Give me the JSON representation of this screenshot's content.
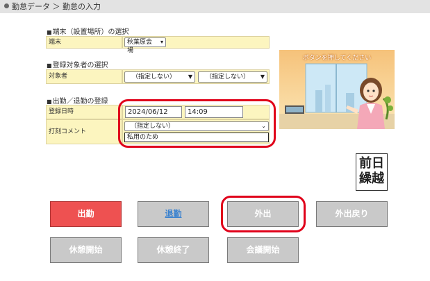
{
  "breadcrumb": {
    "text": "勤怠データ ＞ 勤怠の入力"
  },
  "terminal": {
    "section": "端末（設置場所）の選択",
    "label": "端末",
    "value": "秋葉原会場"
  },
  "target": {
    "section": "登録対象者の選択",
    "label": "対象者",
    "select1": "（指定しない）",
    "select2": "（指定しない）"
  },
  "punch": {
    "section": "出勤／退勤の登録",
    "date_label": "登録日時",
    "date": "2024/06/12",
    "time": "14:09",
    "comment_label": "打刻コメント",
    "comment_select": "（指定しない）",
    "comment_text": "私用のため"
  },
  "illustration": {
    "caption": "ボタンを押してください"
  },
  "prev_day": {
    "line1": "前日",
    "line2": "繰越"
  },
  "buttons": {
    "checkin": "出勤",
    "checkout": "退勤",
    "go_out": "外出",
    "return": "外出戻り",
    "break_start": "休憩開始",
    "break_end": "休憩終了",
    "meeting_start": "会議開始"
  },
  "colors": {
    "highlight": "#e0001a",
    "checkin": "#ee5151",
    "label_bg": "#fcf5bf",
    "button_gray": "#c9c9c9"
  }
}
